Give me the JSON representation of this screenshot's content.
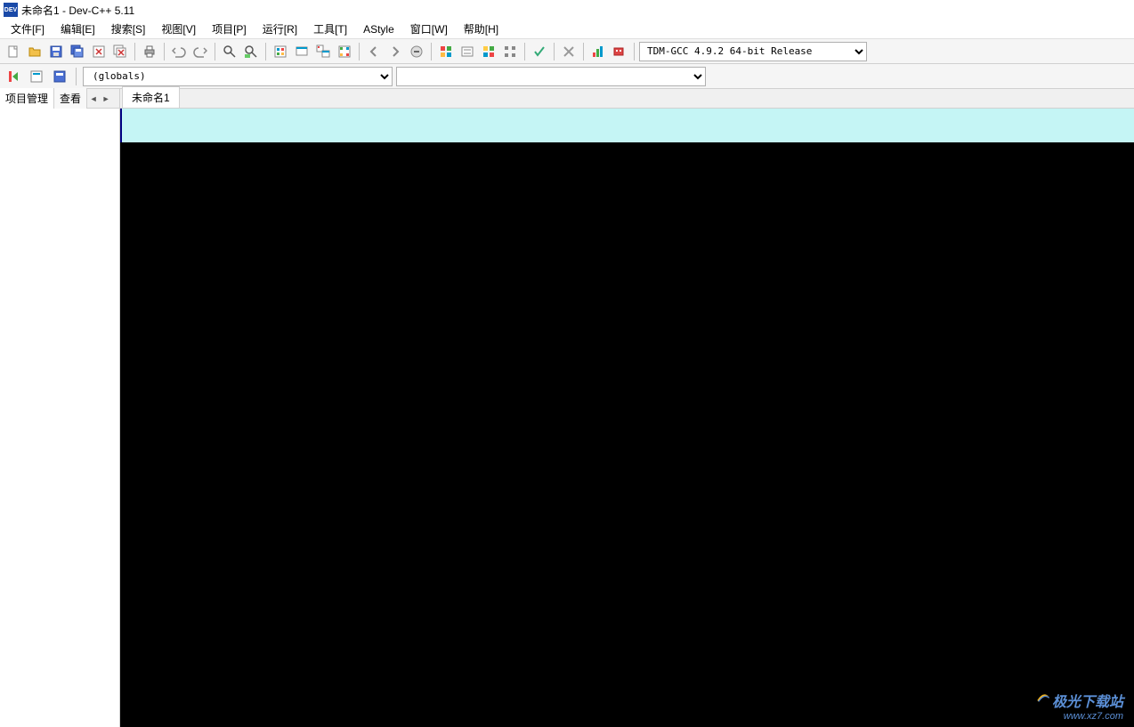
{
  "title": "未命名1 - Dev-C++ 5.11",
  "app_icon_text": "DEV",
  "menus": {
    "file": "文件[F]",
    "edit": "编辑[E]",
    "search": "搜索[S]",
    "view": "视图[V]",
    "project": "项目[P]",
    "run": "运行[R]",
    "tools": "工具[T]",
    "astyle": "AStyle",
    "window": "窗口[W]",
    "help": "帮助[H]"
  },
  "compiler_select": "TDM-GCC 4.9.2 64-bit Release",
  "globals_select": "(globals)",
  "sidebar": {
    "tab1": "项目管理",
    "tab2": "查看"
  },
  "editor_tab": "未命名1",
  "watermark": {
    "text": "极光下载站",
    "url": "www.xz7.com"
  }
}
